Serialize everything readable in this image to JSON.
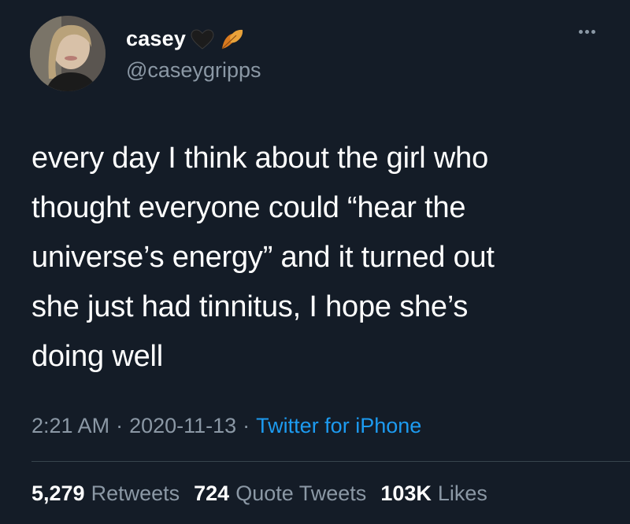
{
  "user": {
    "display_name": "casey",
    "handle": "@caseygripps",
    "emoji_1": "black-heart-icon",
    "emoji_2": "fallen-leaf-icon"
  },
  "tweet": {
    "lines": [
      "every day I think about the girl who",
      "thought everyone could “hear the",
      "universe’s energy” and it turned out",
      "she just had tinnitus, I hope she’s",
      "doing well"
    ],
    "time": "2:21 AM",
    "date": "2020-11-13",
    "separator": "·",
    "source": "Twitter for iPhone"
  },
  "stats": {
    "retweets_count": "5,279",
    "retweets_label": "Retweets",
    "quotes_count": "724",
    "quotes_label": "Quote Tweets",
    "likes_count": "103K",
    "likes_label": "Likes"
  },
  "colors": {
    "background": "#141c27",
    "secondary_text": "#8b98a5",
    "link": "#1d9bf0"
  }
}
